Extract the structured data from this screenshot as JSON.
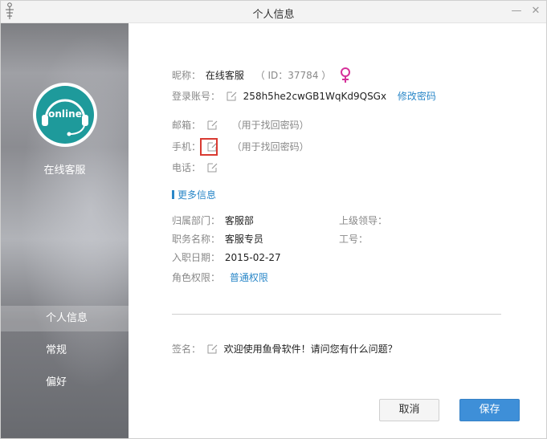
{
  "window": {
    "title": "个人信息",
    "minimize_glyph": "—",
    "close_glyph": "✕"
  },
  "sidebar": {
    "avatar_text": "online",
    "user_name": "在线客服",
    "items": [
      {
        "label": "个人信息",
        "active": true
      },
      {
        "label": "常规",
        "active": false
      },
      {
        "label": "偏好",
        "active": false
      }
    ]
  },
  "profile": {
    "nickname_label": "昵称：",
    "nickname": "在线客服",
    "id_text": "（ ID：37784 ）",
    "gender_icon": "female-icon",
    "account_label": "登录账号：",
    "account": "258h5he2cwGB1WqKd9QSGx",
    "change_password": "修改密码",
    "email_label": "邮箱：",
    "email_hint": "（用于找回密码）",
    "phone_label": "手机：",
    "phone_hint": "（用于找回密码）",
    "tel_label": "电话："
  },
  "more": {
    "title": "更多信息",
    "dept_label": "归属部门：",
    "dept": "客服部",
    "leader_label": "上级领导：",
    "leader": "",
    "position_label": "职务名称：",
    "position": "客服专员",
    "empno_label": "工号：",
    "empno": "",
    "hire_label": "入职日期：",
    "hire_date": "2015-02-27",
    "role_label": "角色权限：",
    "role": "普通权限"
  },
  "signature": {
    "label": "签名：",
    "text": "欢迎使用鱼骨软件！请问您有什么问题？"
  },
  "buttons": {
    "cancel": "取消",
    "save": "保存"
  },
  "colors": {
    "accent": "#2a87c8",
    "save_button": "#3e8fd8",
    "female_icon": "#d6319a",
    "highlight": "#d93a32",
    "avatar": "#1e9a9b"
  }
}
